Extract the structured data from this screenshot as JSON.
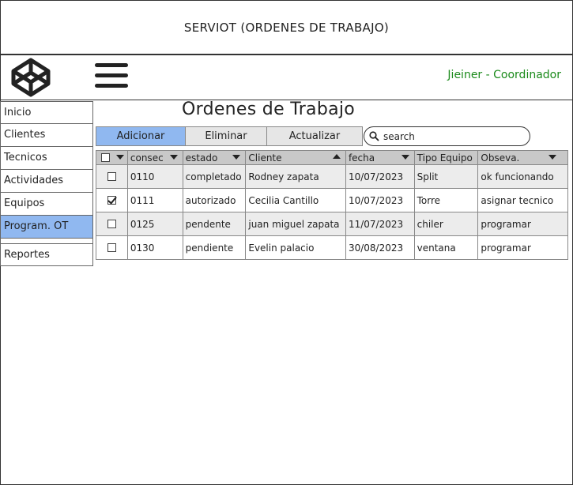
{
  "app": {
    "title": "SERVIOT (ORDENES DE TRABAJO)"
  },
  "header": {
    "user": "Jieiner - Coordinador",
    "logo_icon": "codepen-cube-icon",
    "menu_icon": "hamburger-menu-icon"
  },
  "sidebar": {
    "items": [
      {
        "label": "Inicio"
      },
      {
        "label": "Clientes"
      },
      {
        "label": "Tecnicos"
      },
      {
        "label": "Actividades"
      },
      {
        "label": "Equipos"
      },
      {
        "label": "Program. OT",
        "active": true
      },
      {
        "label": "Reportes"
      }
    ]
  },
  "main": {
    "title": "Ordenes de Trabajo",
    "toolbar": {
      "add": "Adicionar",
      "delete": "Eliminar",
      "refresh": "Actualizar"
    },
    "search": {
      "placeholder": "search",
      "value": ""
    }
  },
  "table": {
    "columns": [
      "consec",
      "estado",
      "Cliente",
      "fecha",
      "Tipo Equipo",
      "Obseva."
    ],
    "rows": [
      {
        "checked": false,
        "consec": "0110",
        "estado": "completado",
        "cliente": "Rodney zapata",
        "fecha": "10/07/2023",
        "tipo": "Split",
        "obs": "ok funcionando"
      },
      {
        "checked": true,
        "consec": "0111",
        "estado": "autorizado",
        "cliente": "Cecilia Cantillo",
        "fecha": "10/07/2023",
        "tipo": "Torre",
        "obs": "asignar tecnico"
      },
      {
        "checked": false,
        "consec": "0125",
        "estado": "pendente",
        "cliente": "juan miguel zapata",
        "fecha": "11/07/2023",
        "tipo": "chiler",
        "obs": "programar"
      },
      {
        "checked": false,
        "consec": "0130",
        "estado": "pendiente",
        "cliente": "Evelin palacio",
        "fecha": "30/08/2023",
        "tipo": "ventana",
        "obs": "programar"
      }
    ]
  },
  "colors": {
    "accent": "#90b8f0",
    "user": "#1a8a1a",
    "header_row": "#c8c8c8",
    "alt_row": "#ececec"
  }
}
